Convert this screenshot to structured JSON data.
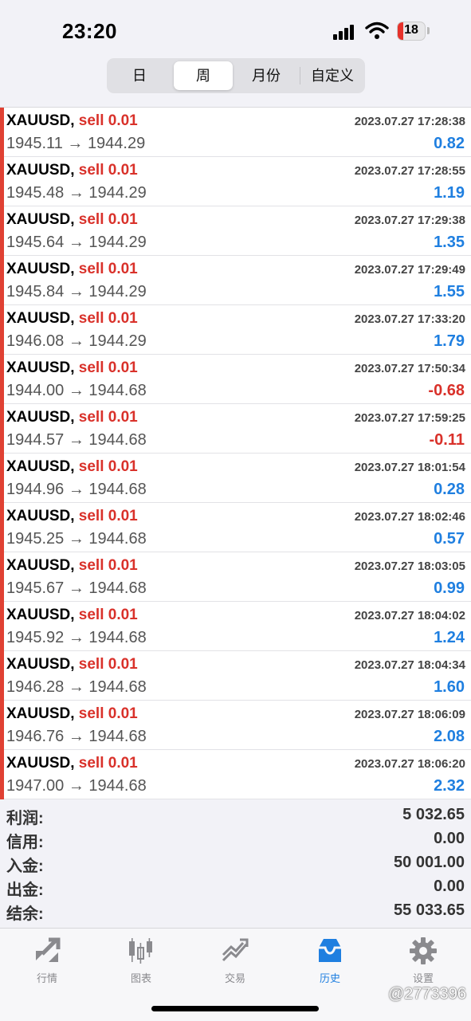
{
  "status": {
    "time": "23:20",
    "battery": "18"
  },
  "segment": {
    "day": "日",
    "week": "周",
    "month": "月份",
    "custom": "自定义",
    "active": "周"
  },
  "trades": [
    {
      "symbol": "XAUUSD,",
      "side": "sell 0.01",
      "datetime": "2023.07.27 17:28:38",
      "open": "1945.11",
      "close": "1944.29",
      "profit": "0.82"
    },
    {
      "symbol": "XAUUSD,",
      "side": "sell 0.01",
      "datetime": "2023.07.27 17:28:55",
      "open": "1945.48",
      "close": "1944.29",
      "profit": "1.19"
    },
    {
      "symbol": "XAUUSD,",
      "side": "sell 0.01",
      "datetime": "2023.07.27 17:29:38",
      "open": "1945.64",
      "close": "1944.29",
      "profit": "1.35"
    },
    {
      "symbol": "XAUUSD,",
      "side": "sell 0.01",
      "datetime": "2023.07.27 17:29:49",
      "open": "1945.84",
      "close": "1944.29",
      "profit": "1.55"
    },
    {
      "symbol": "XAUUSD,",
      "side": "sell 0.01",
      "datetime": "2023.07.27 17:33:20",
      "open": "1946.08",
      "close": "1944.29",
      "profit": "1.79"
    },
    {
      "symbol": "XAUUSD,",
      "side": "sell 0.01",
      "datetime": "2023.07.27 17:50:34",
      "open": "1944.00",
      "close": "1944.68",
      "profit": "-0.68"
    },
    {
      "symbol": "XAUUSD,",
      "side": "sell 0.01",
      "datetime": "2023.07.27 17:59:25",
      "open": "1944.57",
      "close": "1944.68",
      "profit": "-0.11"
    },
    {
      "symbol": "XAUUSD,",
      "side": "sell 0.01",
      "datetime": "2023.07.27 18:01:54",
      "open": "1944.96",
      "close": "1944.68",
      "profit": "0.28"
    },
    {
      "symbol": "XAUUSD,",
      "side": "sell 0.01",
      "datetime": "2023.07.27 18:02:46",
      "open": "1945.25",
      "close": "1944.68",
      "profit": "0.57"
    },
    {
      "symbol": "XAUUSD,",
      "side": "sell 0.01",
      "datetime": "2023.07.27 18:03:05",
      "open": "1945.67",
      "close": "1944.68",
      "profit": "0.99"
    },
    {
      "symbol": "XAUUSD,",
      "side": "sell 0.01",
      "datetime": "2023.07.27 18:04:02",
      "open": "1945.92",
      "close": "1944.68",
      "profit": "1.24"
    },
    {
      "symbol": "XAUUSD,",
      "side": "sell 0.01",
      "datetime": "2023.07.27 18:04:34",
      "open": "1946.28",
      "close": "1944.68",
      "profit": "1.60"
    },
    {
      "symbol": "XAUUSD,",
      "side": "sell 0.01",
      "datetime": "2023.07.27 18:06:09",
      "open": "1946.76",
      "close": "1944.68",
      "profit": "2.08"
    },
    {
      "symbol": "XAUUSD,",
      "side": "sell 0.01",
      "datetime": "2023.07.27 18:06:20",
      "open": "1947.00",
      "close": "1944.68",
      "profit": "2.32"
    }
  ],
  "summary": {
    "profit_label": "利润:",
    "profit": "5 032.65",
    "credit_label": "信用:",
    "credit": "0.00",
    "deposit_label": "入金:",
    "deposit": "50 001.00",
    "withdrawal_label": "出金:",
    "withdrawal": "0.00",
    "balance_label": "结余:",
    "balance": "55 033.65"
  },
  "tabs": {
    "quotes": "行情",
    "chart": "图表",
    "trade": "交易",
    "history": "历史",
    "settings": "设置",
    "active": "历史"
  },
  "watermark": "@2773396",
  "colors": {
    "accent": "#1f7fe0",
    "sell": "#d9312a",
    "row_bar": "#e04133"
  },
  "icons": [
    "signal-icon",
    "wifi-icon",
    "battery-icon",
    "quotes-icon",
    "chart-icon",
    "trade-icon",
    "history-icon",
    "settings-icon"
  ]
}
